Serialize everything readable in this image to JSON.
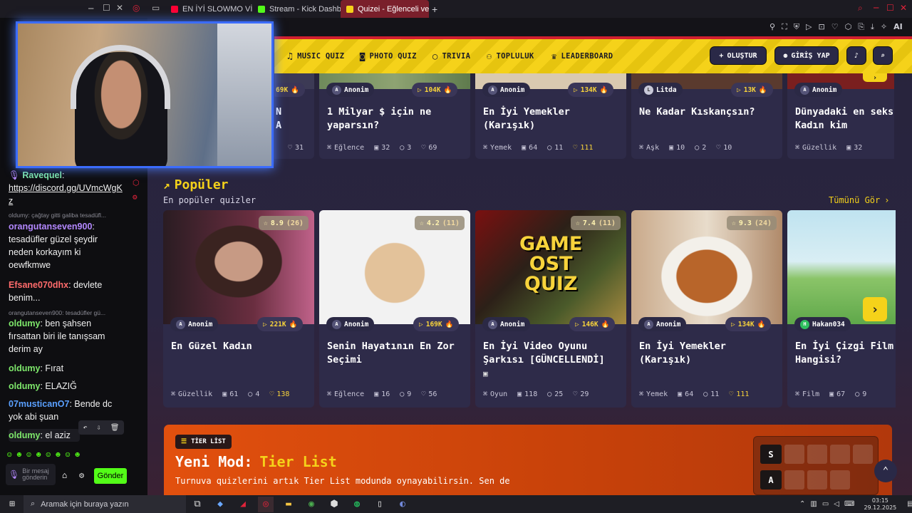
{
  "browser": {
    "tabs": [
      {
        "label": "EN İYİ SLOWMO VİDEOLA",
        "favicon_color": "#ff0033",
        "active": false
      },
      {
        "label": "Stream - Kick Dashboard",
        "favicon_color": "#53fc18",
        "active": false
      },
      {
        "label": "Quizei - Eğlenceli ve etkile",
        "favicon_color": "#f5d21a",
        "active": true
      }
    ],
    "new_tab": "+",
    "ai_label": "AI"
  },
  "chat": {
    "messages": [
      {
        "user": "Ravequel",
        "color": "#7ee8a8",
        "text": "https://discord.gg/UVmcWgKz",
        "reply": ""
      },
      {
        "user": "orangutanseven900",
        "color": "#b388ff",
        "text": "tesadüfler güzel şeydir neden korkayım ki oewfkmwe",
        "reply": "oldumy: çağtay gitti galiba tesadüfl..."
      },
      {
        "user": "Efsane070dhx",
        "color": "#ff6b6b",
        "text": "devlete benim...",
        "reply": ""
      },
      {
        "user": "oldumy",
        "color": "#7ee86b",
        "text": "ben şahsen fırsattan biri ile tanışsam derim ay",
        "reply": "orangutanseven900: tesadüfler gü..."
      },
      {
        "user": "oldumy",
        "color": "#7ee86b",
        "text": "Fırat",
        "reply": ""
      },
      {
        "user": "oldumy",
        "color": "#7ee86b",
        "text": "ELAZIĞ",
        "reply": ""
      },
      {
        "user": "07musticanO7",
        "color": "#5aa0ff",
        "text": "Bende dc yok abi şuan",
        "reply": ""
      },
      {
        "user": "oldumy",
        "color": "#7ee86b",
        "text": "el aziz",
        "reply": ""
      }
    ],
    "input_placeholder": "Bir mesaj gönderin",
    "send_label": "Gönder"
  },
  "nav": {
    "items": [
      {
        "label": "MUSIC QUIZ",
        "icon": "music-icon"
      },
      {
        "label": "PHOTO QUIZ",
        "icon": "camera-icon"
      },
      {
        "label": "TRIVIA",
        "icon": "chat-icon"
      },
      {
        "label": "TOPLULUK",
        "icon": "users-icon"
      },
      {
        "label": "LEADERBOARD",
        "icon": "trophy-icon"
      }
    ],
    "create_label": "OLUŞTUR",
    "login_label": "GİRİŞ YAP"
  },
  "top_row": [
    {
      "author": "",
      "plays": "69K",
      "title": "N A",
      "category": "",
      "questions": "",
      "comments": "",
      "likes": "31"
    },
    {
      "author": "Anonim",
      "plays": "104K",
      "title": "1 Milyar $ için ne yaparsın?",
      "category": "Eğlence",
      "questions": "32",
      "comments": "3",
      "likes": "69"
    },
    {
      "author": "Anonim",
      "plays": "134K",
      "title": "En İyi Yemekler (Karışık)",
      "category": "Yemek",
      "questions": "64",
      "comments": "11",
      "likes": "111"
    },
    {
      "author": "Litda",
      "plays": "13K",
      "title": "Ne Kadar Kıskançsın?",
      "category": "Aşk",
      "questions": "10",
      "comments": "2",
      "likes": "10"
    },
    {
      "author": "Anonim",
      "plays": "",
      "title": "Dünyadaki en seks Kadın kim",
      "category": "Güzellik",
      "questions": "32",
      "comments": "",
      "likes": ""
    }
  ],
  "popular": {
    "title": "Popüler",
    "subtitle": "En popüler quizler",
    "see_all": "Tümünü Gör",
    "cards": [
      {
        "rating": "8.9",
        "count": "(26)",
        "author": "Anonim",
        "plays": "221K",
        "title": "En Güzel Kadın",
        "category": "Güzellik",
        "questions": "61",
        "comments": "4",
        "likes": "138"
      },
      {
        "rating": "4.2",
        "count": "(11)",
        "author": "Anonim",
        "plays": "169K",
        "title": "Senin Hayatının En Zor Seçimi",
        "category": "Eğlence",
        "questions": "16",
        "comments": "9",
        "likes": "56"
      },
      {
        "rating": "7.4",
        "count": "(11)",
        "author": "Anonim",
        "plays": "146K",
        "title": "En İyi Video Oyunu Şarkısı [GÜNCELLENDİ]",
        "category": "Oyun",
        "questions": "118",
        "comments": "25",
        "likes": "29",
        "image_text": [
          "GAME",
          "OST",
          "QUIZ"
        ]
      },
      {
        "rating": "9.3",
        "count": "(24)",
        "author": "Anonim",
        "plays": "134K",
        "title": "En İyi Yemekler (Karışık)",
        "category": "Yemek",
        "questions": "64",
        "comments": "11",
        "likes": "111"
      },
      {
        "rating": "",
        "count": "",
        "author": "Hakan034",
        "plays": "",
        "title": "En İyi Çizgi Film Hangisi?",
        "category": "Film",
        "questions": "67",
        "comments": "9",
        "likes": ""
      }
    ]
  },
  "tier": {
    "badge": "TİER LİST",
    "heading_prefix": "Yeni Mod:",
    "heading_accent": "Tier List",
    "text": "Turnuva quizlerini artık Tier List modunda oynayabilirsin. Sen de",
    "rows": [
      "S",
      "A"
    ]
  },
  "taskbar": {
    "search_placeholder": "Aramak için buraya yazın",
    "time": "03:15",
    "date": "29.12.2025"
  }
}
